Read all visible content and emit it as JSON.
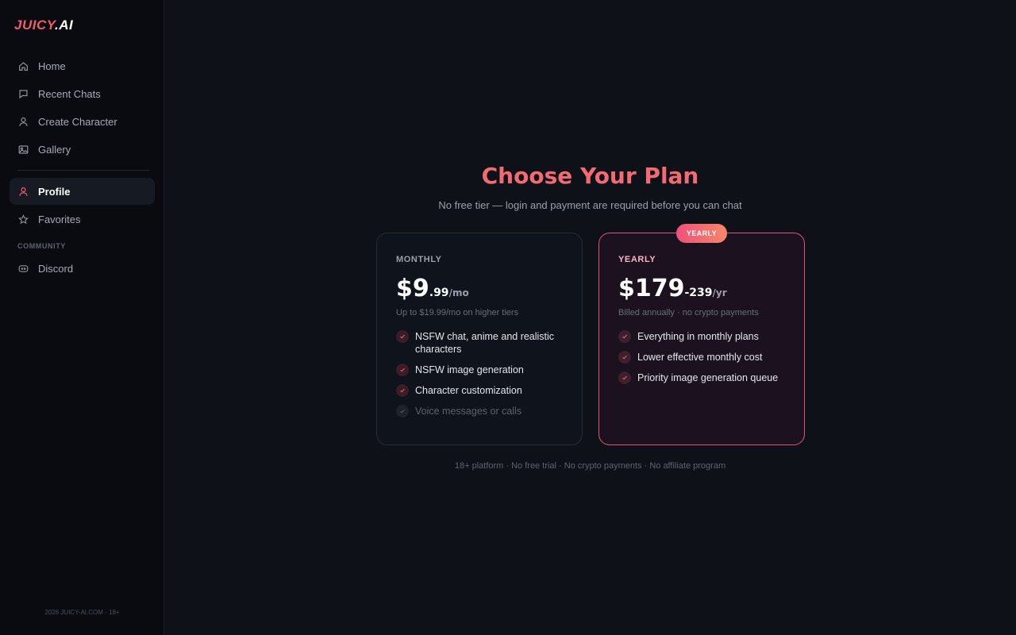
{
  "brand": {
    "logo_part1": "JUICY",
    "logo_part2": ".AI",
    "accent_color": "#f25a6e"
  },
  "sidebar": {
    "items": [
      {
        "label": "Home",
        "icon": "home-icon"
      },
      {
        "label": "Recent Chats",
        "icon": "chat-icon"
      },
      {
        "label": "Create Character",
        "icon": "user-icon"
      },
      {
        "label": "Gallery",
        "icon": "image-icon"
      },
      {
        "label": "Profile",
        "icon": "user-icon",
        "active": true
      },
      {
        "label": "Favorites",
        "icon": "star-icon"
      },
      {
        "label": "Discord",
        "icon": "discord-icon"
      }
    ],
    "section_label": "COMMUNITY",
    "footer": "2026 JUICY-AI.COM · 18+"
  },
  "main": {
    "title": "Choose Your Plan",
    "subtitle": "No free tier — login and payment are required before you can chat",
    "plans": [
      {
        "label": "MONTHLY",
        "price_main": "$9",
        "price_cents": ".99",
        "price_unit": "/mo",
        "note": "Up to $19.99/mo on higher tiers",
        "features": [
          {
            "text": "NSFW chat, anime and realistic characters",
            "enabled": true
          },
          {
            "text": "NSFW image generation",
            "enabled": true
          },
          {
            "text": "Character customization",
            "enabled": true
          },
          {
            "text": "Voice messages or calls",
            "enabled": false
          }
        ]
      },
      {
        "label": "YEARLY",
        "badge": "YEARLY",
        "price_main": "$179",
        "price_cents": "-239",
        "price_unit": "/yr",
        "note": "Billed annually · no crypto payments",
        "features": [
          {
            "text": "Everything in monthly plans",
            "enabled": true
          },
          {
            "text": "Lower effective monthly cost",
            "enabled": true
          },
          {
            "text": "Priority image generation queue",
            "enabled": true
          }
        ]
      }
    ],
    "legal": "18+ platform · No free trial · No crypto payments · No affiliate program"
  }
}
